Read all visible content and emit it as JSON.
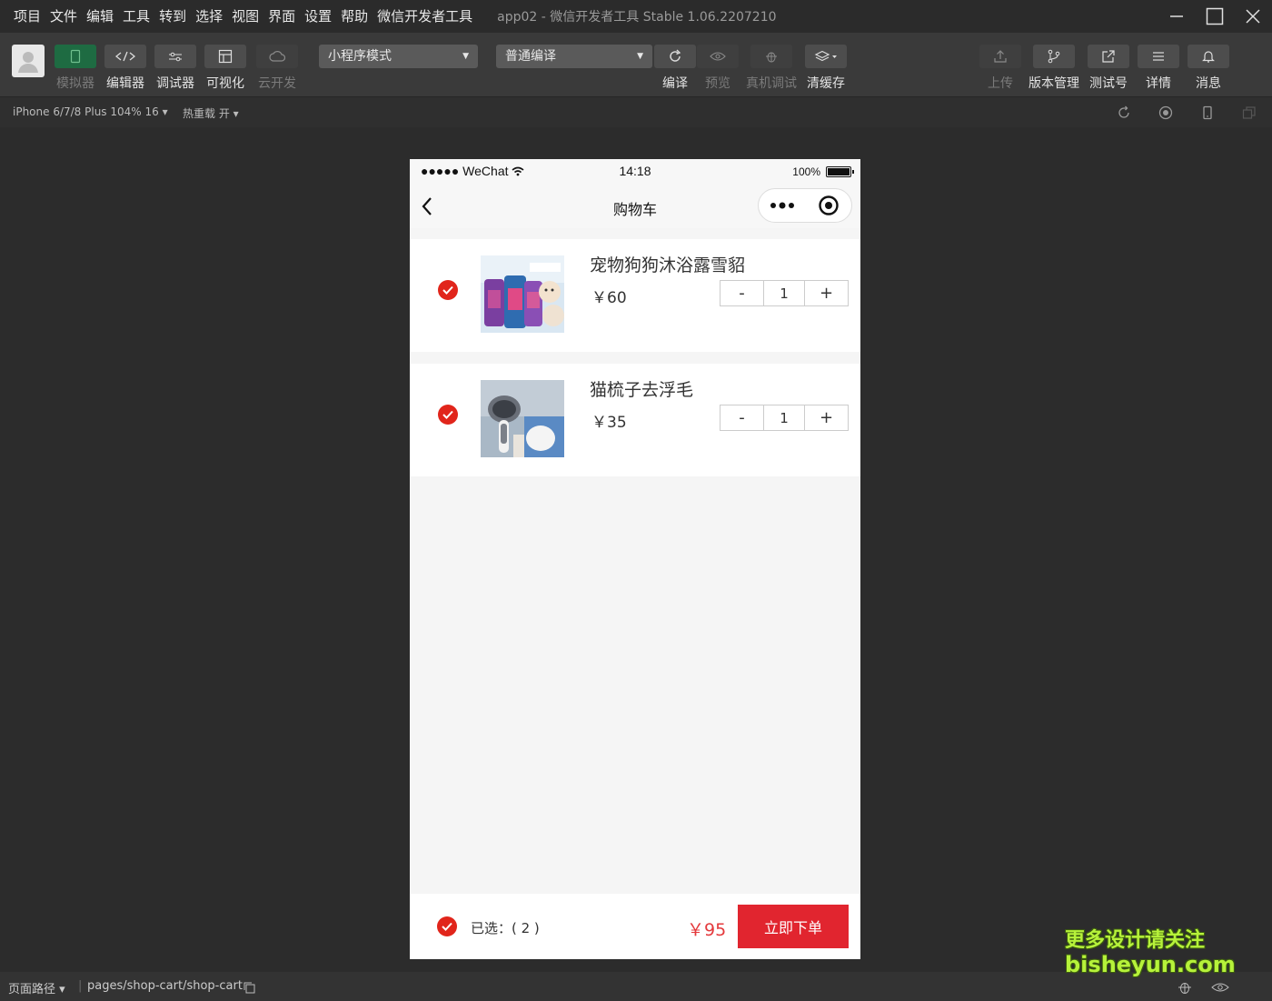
{
  "menubar": {
    "items": [
      "项目",
      "文件",
      "编辑",
      "工具",
      "转到",
      "选择",
      "视图",
      "界面",
      "设置",
      "帮助",
      "微信开发者工具"
    ],
    "app_title": "app02 - 微信开发者工具 Stable 1.06.2207210"
  },
  "toolbar": {
    "simulator": "模拟器",
    "editor": "编辑器",
    "debugger": "调试器",
    "visual": "可视化",
    "cloud": "云开发",
    "mode_select": "小程序模式",
    "compile_select": "普通编译",
    "compile": "编译",
    "preview": "预览",
    "remote_debug": "真机调试",
    "clear_cache": "清缓存",
    "upload": "上传",
    "version": "版本管理",
    "test_account": "测试号",
    "details": "详情",
    "messages": "消息"
  },
  "subbar": {
    "device": "iPhone 6/7/8 Plus 104% 16 ▾",
    "hot_reload": "热重载 开 ▾"
  },
  "phone": {
    "status": {
      "carrier": "●●●●● WeChat",
      "time": "14:18",
      "battery": "100%"
    },
    "nav_title": "购物车",
    "items": [
      {
        "name": "宠物狗狗沐浴露雪貂",
        "price": "￥60",
        "qty": "1",
        "minus": "-",
        "plus": "+"
      },
      {
        "name": "猫梳子去浮毛",
        "price": "￥35",
        "qty": "1",
        "minus": "-",
        "plus": "+"
      }
    ],
    "footer": {
      "selected": "已选：( 2 )",
      "total": "￥95",
      "order_button": "立即下单"
    }
  },
  "bottombar": {
    "path_label": "页面路径 ▾",
    "path": "pages/shop-cart/shop-cart"
  },
  "watermark": {
    "line1": "更多设计请关注",
    "line2": "bisheyun.com"
  },
  "colors": {
    "accent_red": "#e1251b",
    "price_red": "#e4393c",
    "toolbar_bg": "#3a3a3a"
  }
}
